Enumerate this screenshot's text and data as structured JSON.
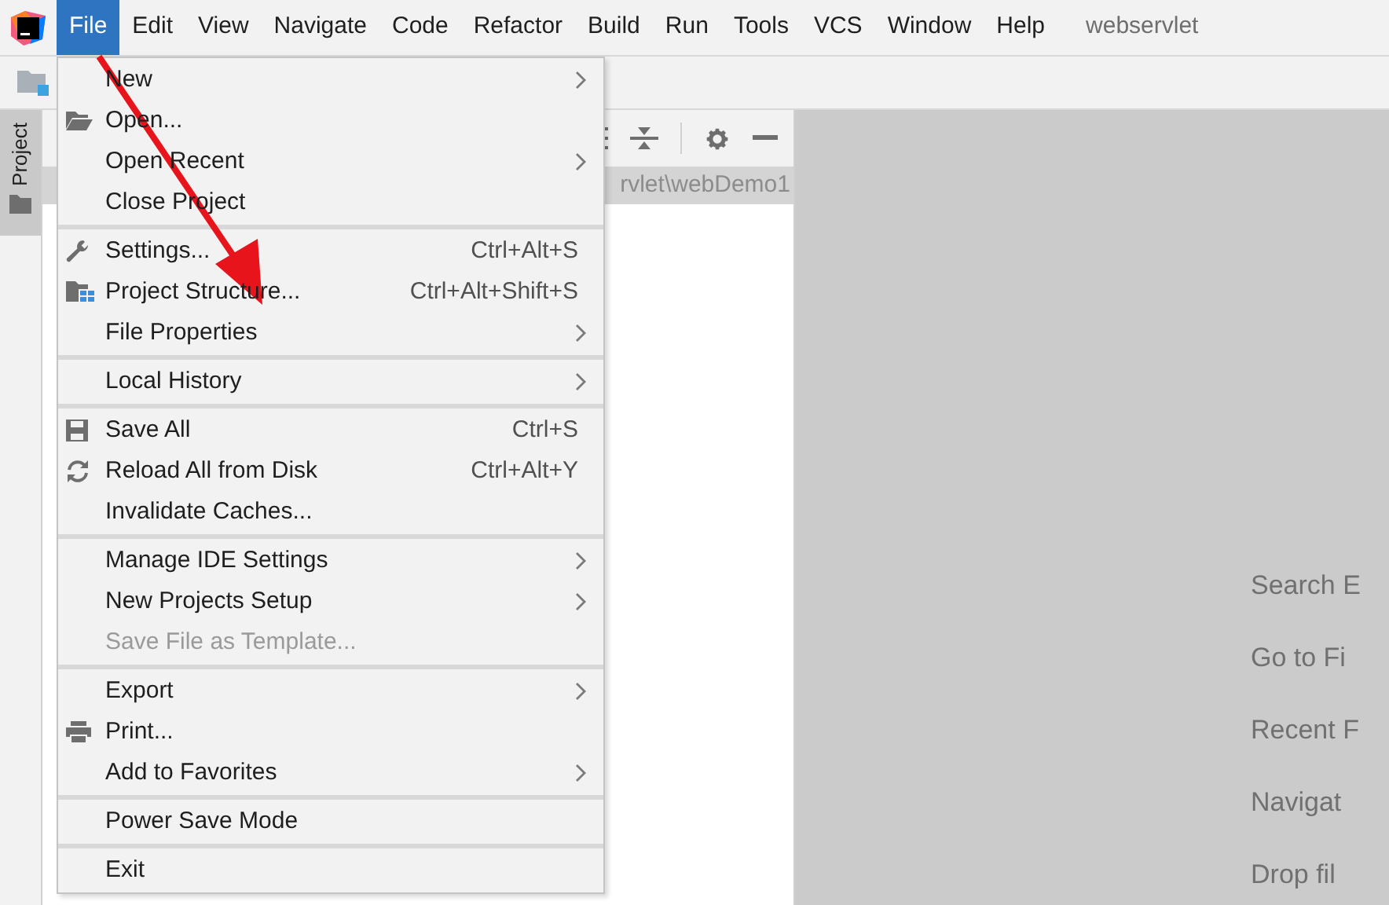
{
  "menu_bar": {
    "items": [
      {
        "label": "File",
        "selected": true
      },
      {
        "label": "Edit",
        "selected": false
      },
      {
        "label": "View",
        "selected": false
      },
      {
        "label": "Navigate",
        "selected": false
      },
      {
        "label": "Code",
        "selected": false
      },
      {
        "label": "Refactor",
        "selected": false
      },
      {
        "label": "Build",
        "selected": false
      },
      {
        "label": "Run",
        "selected": false
      },
      {
        "label": "Tools",
        "selected": false
      },
      {
        "label": "VCS",
        "selected": false
      },
      {
        "label": "Window",
        "selected": false
      },
      {
        "label": "Help",
        "selected": false
      }
    ],
    "project_title": "webservlet"
  },
  "tool_window_stripe": {
    "tab": "Project"
  },
  "project_panel": {
    "path": "rvlet\\webDemo1"
  },
  "file_menu": {
    "sections": [
      [
        {
          "label": "New",
          "submenu": true,
          "disabled": false
        },
        {
          "label": "Open...",
          "submenu": false,
          "disabled": false
        },
        {
          "label": "Open Recent",
          "submenu": true,
          "disabled": false
        },
        {
          "label": "Close Project",
          "submenu": false,
          "disabled": false
        }
      ],
      [
        {
          "label": "Settings...",
          "shortcut": "Ctrl+Alt+S",
          "submenu": false,
          "disabled": false
        },
        {
          "label": "Project Structure...",
          "shortcut": "Ctrl+Alt+Shift+S",
          "submenu": false,
          "disabled": false
        },
        {
          "label": "File Properties",
          "submenu": true,
          "disabled": false
        }
      ],
      [
        {
          "label": "Local History",
          "submenu": true,
          "disabled": false
        }
      ],
      [
        {
          "label": "Save All",
          "shortcut": "Ctrl+S",
          "submenu": false,
          "disabled": false
        },
        {
          "label": "Reload All from Disk",
          "shortcut": "Ctrl+Alt+Y",
          "submenu": false,
          "disabled": false
        },
        {
          "label": "Invalidate Caches...",
          "submenu": false,
          "disabled": false
        }
      ],
      [
        {
          "label": "Manage IDE Settings",
          "submenu": true,
          "disabled": false
        },
        {
          "label": "New Projects Setup",
          "submenu": true,
          "disabled": false
        },
        {
          "label": "Save File as Template...",
          "submenu": false,
          "disabled": true
        }
      ],
      [
        {
          "label": "Export",
          "submenu": true,
          "disabled": false
        },
        {
          "label": "Print...",
          "submenu": false,
          "disabled": false
        },
        {
          "label": "Add to Favorites",
          "submenu": true,
          "disabled": false
        }
      ],
      [
        {
          "label": "Power Save Mode",
          "submenu": false,
          "disabled": false
        }
      ],
      [
        {
          "label": "Exit",
          "submenu": false,
          "disabled": false
        }
      ]
    ]
  },
  "editor_hints": [
    "Search E",
    "Go to Fi",
    "Recent F",
    "Navigat",
    "Drop fil"
  ]
}
